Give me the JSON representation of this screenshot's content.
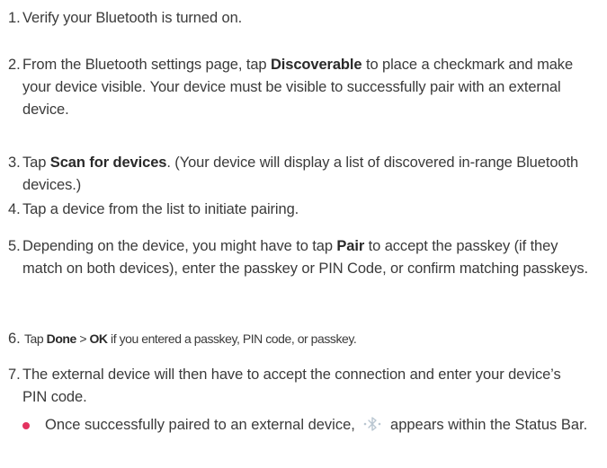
{
  "steps": [
    {
      "num": "1.",
      "parts": [
        "Verify your Bluetooth is turned on."
      ]
    },
    {
      "num": "2.",
      "pre": "From the Bluetooth settings page, tap ",
      "bold": "Discoverable",
      "post": " to place a checkmark and make your device visible. Your device must be visible to successfully pair with an external device."
    },
    {
      "num": "3.",
      "pre": "Tap ",
      "bold": "Scan for devices",
      "post": ". (Your device will display a list of discovered in-range Bluetooth devices.)"
    },
    {
      "num": "4.",
      "parts": [
        "Tap a device from the list to initiate pairing."
      ]
    },
    {
      "num": "5.",
      "pre": "Depending on the device, you might have to tap ",
      "bold": "Pair",
      "post": " to accept the passkey (if they match on both devices), enter the passkey or PIN Code, or confirm matching passkeys."
    },
    {
      "num": "6.",
      "pre": "Tap ",
      "bold1": "Done",
      "sep": " > ",
      "bold2": "OK",
      "post": " if you entered a passkey, PIN code, or passkey."
    },
    {
      "num": "7.",
      "parts": [
        "The external device will then have to accept the connection and enter your device’s PIN code."
      ]
    }
  ],
  "bullet": {
    "pre": "Once successfully paired to an external device, ",
    "post": " appears within the Status Bar.",
    "icon": "bluetooth-connected-icon"
  },
  "colors": {
    "text": "#3a3a3a",
    "bullet": "#e3325f",
    "icon": "#b9c6d1"
  }
}
